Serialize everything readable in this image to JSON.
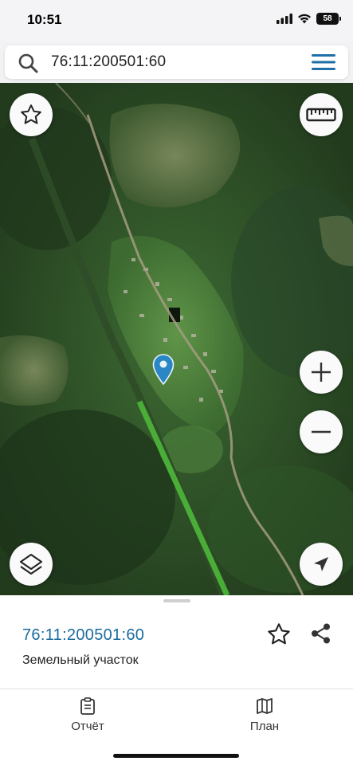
{
  "status_bar": {
    "time": "10:51",
    "battery": "58",
    "icons": [
      "cellular-signal-icon",
      "wifi-icon",
      "battery-icon"
    ]
  },
  "search": {
    "query": "76:11:200501:60",
    "icons": [
      "search-icon",
      "hamburger-menu-icon"
    ]
  },
  "map_controls": {
    "icons": [
      "star-icon",
      "ruler-icon",
      "zoom-in-icon",
      "zoom-out-icon",
      "layers-icon",
      "locate-arrow-icon",
      "map-pin-icon"
    ]
  },
  "parcel": {
    "cadastral_number": "76:11:200501:60",
    "type": "Земельный участок",
    "accent_color": "#1a6b9e"
  },
  "tabs": [
    {
      "label": "Отчёт",
      "icon": "clipboard-icon"
    },
    {
      "label": "План",
      "icon": "map-icon"
    }
  ],
  "colors": {
    "pin": "#2a86c4",
    "forest": "#2c4a26"
  }
}
